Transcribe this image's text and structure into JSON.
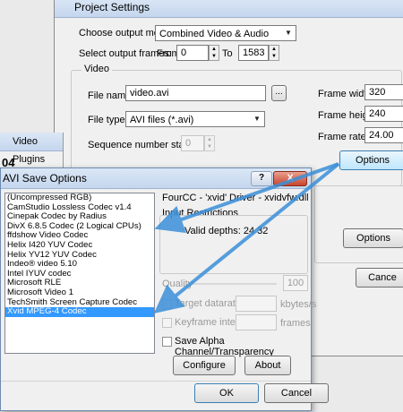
{
  "project_settings": {
    "title": "Project Settings",
    "output_mode_label": "Choose output mode",
    "output_mode_value": "Combined Video & Audio",
    "frames_label": "Select output frames:",
    "from_label": "From",
    "from_value": "0",
    "to_label": "To",
    "to_value": "1583",
    "video_group_label": "Video",
    "file_name_label": "File name",
    "file_name_value": "video.avi",
    "browse_label": "...",
    "file_type_label": "File type",
    "file_type_value": "AVI files (*.avi)",
    "sequence_label": "Sequence number start",
    "sequence_value": "0",
    "frame_width_label": "Frame width",
    "frame_width_value": "320",
    "frame_height_label": "Frame height",
    "frame_height_value": "240",
    "frame_rate_label": "Frame rate",
    "frame_rate_value": "24.00",
    "options_label": "Options",
    "options2_label": "Options",
    "cancel_partial": "Cance"
  },
  "video_plugins": {
    "title": "Video Plugins",
    "partial_text": "04"
  },
  "avi_dialog": {
    "title": "AVI Save Options",
    "help_label": "?",
    "close_label": "X",
    "codecs": [
      "(Uncompressed RGB)",
      "CamStudio Lossless Codec v1.4",
      "Cinepak Codec by Radius",
      "DivX 6.8.5 Codec (2 Logical CPUs)",
      "ffdshow Video Codec",
      "Helix I420 YUV Codec",
      "Helix YV12 YUV Codec",
      "Indeo® video 5.10",
      "Intel IYUV codec",
      "Microsoft RLE",
      "Microsoft Video 1",
      "TechSmith Screen Capture Codec",
      "Xvid MPEG-4 Codec"
    ],
    "selected_codec": "Xvid MPEG-4 Codec",
    "fourcc_label": "FourCC - 'xvid'",
    "driver_label": "Driver - xvidvfw.dll",
    "input_restrictions_label": "Input Restrictions",
    "valid_depths": "Valid depths: 24 32",
    "quality_label": "Quality",
    "quality_value": "100",
    "target_datarate_label": "Target datarate",
    "datarate_unit": "kbytes/s",
    "keyframe_label": "Keyframe interval",
    "keyframe_unit": "frames",
    "save_alpha_label": "Save Alpha Channel/Transparency",
    "configure_label": "Configure",
    "about_label": "About",
    "ok_label": "OK",
    "cancel_label": "Cancel"
  },
  "colors": {
    "selection": "#3399ff",
    "arrow": "#3b8fd9"
  }
}
